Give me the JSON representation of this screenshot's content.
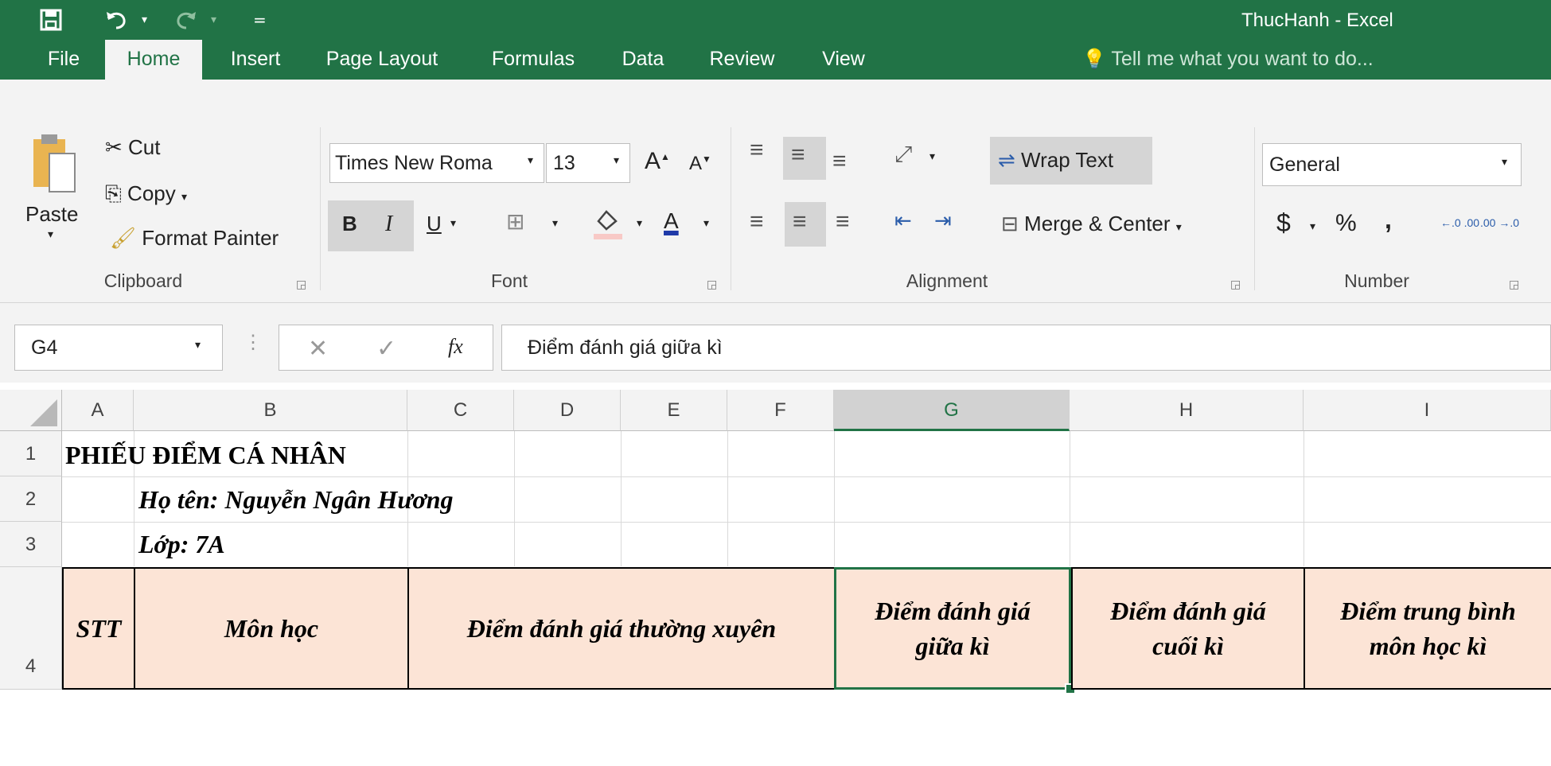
{
  "app": {
    "title": "ThucHanh - Excel",
    "accent": "#217346",
    "qat": {
      "save_icon": "save-icon",
      "undo_icon": "undo-icon",
      "redo_icon": "redo-icon",
      "customize_icon": "qat-customize-icon"
    }
  },
  "tabs": [
    {
      "label": "File"
    },
    {
      "label": "Home"
    },
    {
      "label": "Insert"
    },
    {
      "label": "Page Layout"
    },
    {
      "label": "Formulas"
    },
    {
      "label": "Data"
    },
    {
      "label": "Review"
    },
    {
      "label": "View"
    }
  ],
  "tell_me": "Tell me what you want to do...",
  "clipboard": {
    "paste": "Paste",
    "cut": "Cut",
    "copy": "Copy",
    "format_painter": "Format Painter",
    "label": "Clipboard"
  },
  "font": {
    "name": "Times New Roma",
    "size": "13",
    "bold": "B",
    "italic": "I",
    "underline": "U",
    "font_color": "A",
    "grow": "A",
    "shrink": "A",
    "label": "Font"
  },
  "alignment": {
    "wrap_text": "Wrap Text",
    "merge_center": "Merge & Center",
    "label": "Alignment"
  },
  "number": {
    "format": "General",
    "currency": "$",
    "percent": "%",
    "comma": ",",
    "inc_decimal": "←.0 .00",
    "dec_decimal": ".00 →.0",
    "label": "Number"
  },
  "formula_bar": {
    "name_box": "G4",
    "cancel": "✕",
    "enter": "✓",
    "fx": "fx",
    "content": "Điểm đánh giá giữa kì"
  },
  "columns": [
    "A",
    "B",
    "C",
    "D",
    "E",
    "F",
    "G",
    "H",
    "I"
  ],
  "rows": [
    "1",
    "2",
    "3",
    "4"
  ],
  "cells": {
    "a1": "PHIẾU ĐIỂM CÁ NHÂN",
    "b2": "Họ tên: Nguyễn Ngân Hương",
    "b3": "Lớp: 7A"
  },
  "headers": {
    "stt": "STT",
    "mon_hoc": "Môn học",
    "thuong_xuyen": "Điểm đánh giá thường xuyên",
    "giua_ki_1": "Điểm đánh giá",
    "giua_ki_2": "giữa kì",
    "cuoi_ki_1": "Điểm đánh giá",
    "cuoi_ki_2": "cuối kì",
    "tb_1": "Điểm trung bình",
    "tb_2": "môn học kì"
  }
}
